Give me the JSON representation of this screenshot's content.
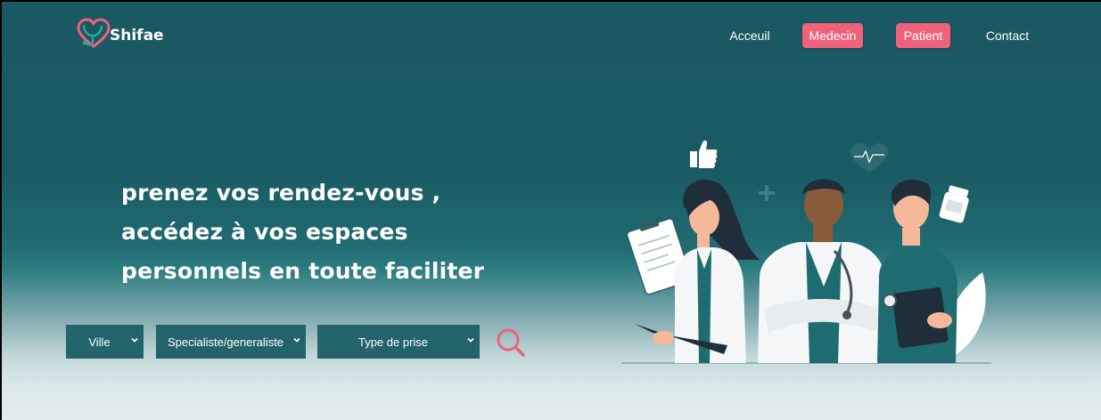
{
  "brand": {
    "name": "Shifae",
    "accent": "#f0617a",
    "teal": "#1b5962"
  },
  "nav": {
    "items": [
      {
        "label": "Acceuil",
        "highlighted": false
      },
      {
        "label": "Medecin",
        "highlighted": true
      },
      {
        "label": "Patient",
        "highlighted": true
      },
      {
        "label": "Contact",
        "highlighted": false
      }
    ]
  },
  "hero": {
    "lines": [
      "prenez vos rendez-vous ,",
      "accédez à vos espaces",
      "personnels en toute faciliter"
    ]
  },
  "filters": {
    "ville": "Ville",
    "specialite": "Specialiste/generaliste",
    "type": "Type de prise"
  },
  "icons": {
    "logo": "heart-stethoscope-icon",
    "search": "search-icon",
    "dropdown": "chevron-down-icon"
  }
}
